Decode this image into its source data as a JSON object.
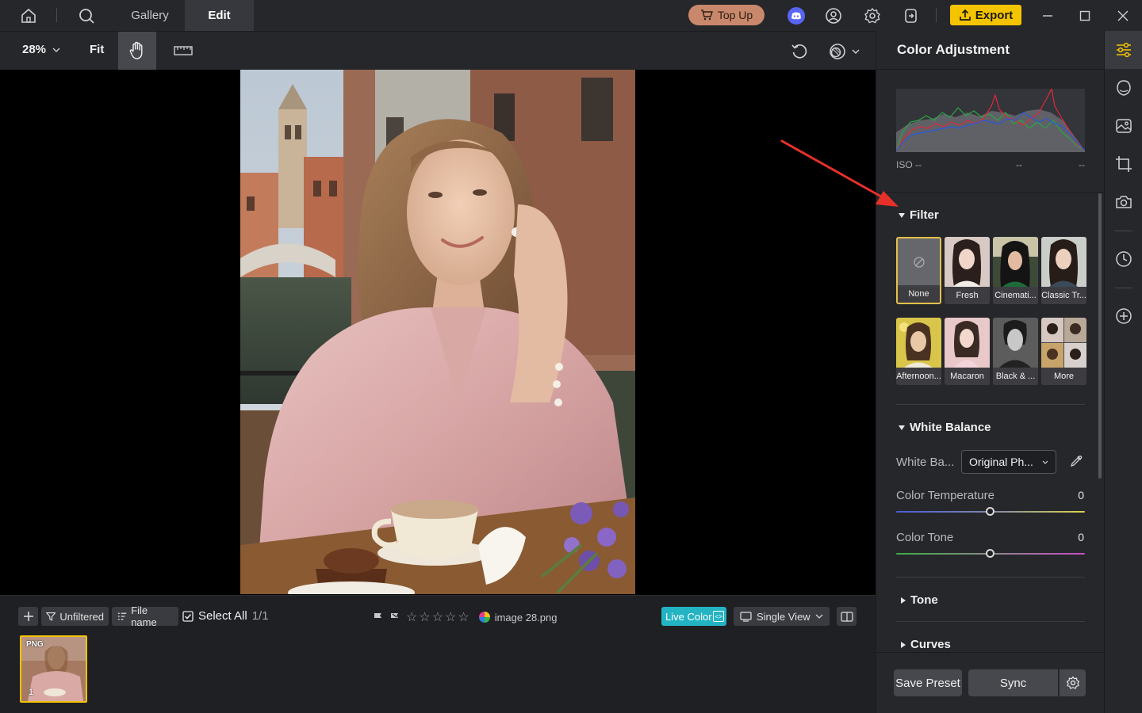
{
  "topbar": {
    "tabs": [
      {
        "label": "Gallery"
      },
      {
        "label": "Edit"
      }
    ],
    "topup_label": "Top Up",
    "export_label": "Export",
    "icons": [
      "home-icon",
      "search-icon",
      "discord-icon",
      "account-icon",
      "settings-icon",
      "sign-in-icon",
      "minimize-icon",
      "maximize-icon",
      "close-icon"
    ]
  },
  "toolbar": {
    "zoom": "28%",
    "fit_label": "Fit"
  },
  "bottombar": {
    "filter_label": "Unfiltered",
    "sort_label": "File name",
    "select_all_label": "Select All",
    "selection_count": "1/1",
    "filename": "image 28.png",
    "live_color_label": "Live Color",
    "view_label": "Single View",
    "thumbnail": {
      "badge": "PNG",
      "index": "1"
    }
  },
  "panel": {
    "title": "Color Adjustment",
    "histogram": {
      "iso": "ISO --",
      "mid": "--",
      "right": "--"
    },
    "sections": {
      "filter": "Filter",
      "white_balance": "White Balance",
      "tone": "Tone",
      "curves": "Curves"
    },
    "filters": [
      {
        "label": "None"
      },
      {
        "label": "Fresh"
      },
      {
        "label": "Cinemati..."
      },
      {
        "label": "Classic Tr..."
      },
      {
        "label": "Afternoon..."
      },
      {
        "label": "Macaron"
      },
      {
        "label": "Black & ..."
      },
      {
        "label": "More"
      }
    ],
    "selected_filter": "None",
    "white_balance": {
      "label": "White Ba...",
      "mode": "Original Ph..."
    },
    "sliders": [
      {
        "label": "Color Temperature",
        "value": "0"
      },
      {
        "label": "Color Tone",
        "value": "0"
      }
    ],
    "save_preset_label": "Save Preset",
    "sync_label": "Sync"
  },
  "colors": {
    "accent_yellow": "#f4c400",
    "live_color": "#23b4c4",
    "topup": "#c9886b",
    "annotation_arrow": "#e8302a"
  }
}
